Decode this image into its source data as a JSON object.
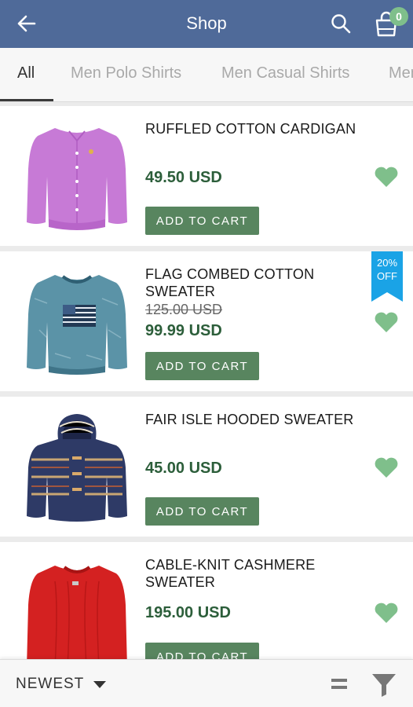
{
  "appbar": {
    "title": "Shop",
    "back_icon": "arrow-left-icon",
    "search_icon": "search-icon",
    "cart_icon": "shopping-bag-icon",
    "cart_count": "0"
  },
  "tabs": [
    {
      "label": "All",
      "active": true
    },
    {
      "label": "Men Polo Shirts",
      "active": false
    },
    {
      "label": "Men Casual Shirts",
      "active": false
    },
    {
      "label": "Men",
      "active": false
    }
  ],
  "products": [
    {
      "name": "RUFFLED COTTON CARDIGAN",
      "price": "49.50 USD",
      "old_price": "",
      "button": "ADD TO CART",
      "badge": "",
      "image": "purple-cardigan"
    },
    {
      "name": "FLAG COMBED COTTON SWEATER",
      "price": "99.99 USD",
      "old_price": "125.00 USD",
      "button": "ADD TO CART",
      "badge_line1": "20%",
      "badge_line2": "OFF",
      "image": "blue-flag-sweater"
    },
    {
      "name": "FAIR ISLE HOODED SWEATER",
      "price": "45.00 USD",
      "old_price": "",
      "button": "ADD TO CART",
      "badge": "",
      "image": "fair-isle-hoodie"
    },
    {
      "name": "CABLE-KNIT CASHMERE SWEATER",
      "price": "195.00 USD",
      "old_price": "",
      "button": "ADD TO CART",
      "badge": "",
      "image": "red-cable-sweater"
    }
  ],
  "bottombar": {
    "sort_label": "NEWEST",
    "view_icon": "list-view-icon",
    "filter_icon": "filter-funnel-icon"
  },
  "colors": {
    "appbar": "#4f6a99",
    "button": "#58855f",
    "price": "#2c5e3a",
    "heart": "#7fbf8b",
    "ribbon": "#1aa3e6"
  }
}
